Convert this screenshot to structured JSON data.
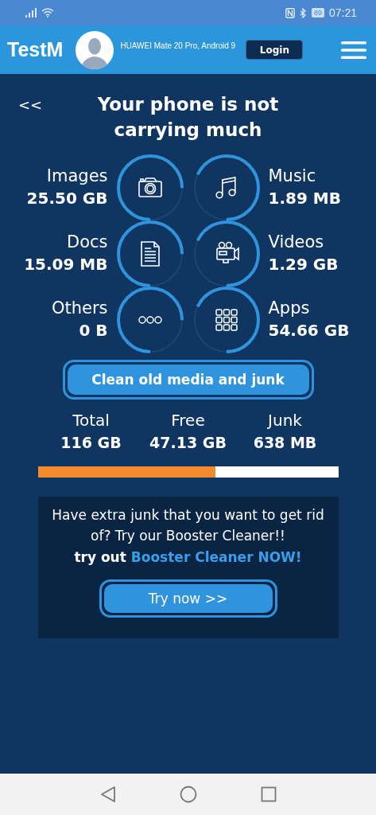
{
  "status_bar": {
    "battery": "89",
    "time": "07:21"
  },
  "header": {
    "logo": "TestM",
    "device": "HUAWEI Mate 20 Pro, Android 9",
    "login": "Login"
  },
  "back": "<<",
  "title": "Your phone is not carrying much",
  "categories": [
    {
      "label": "Images",
      "size": "25.50 GB",
      "kind": "camera"
    },
    {
      "label": "Music",
      "size": "1.89 MB",
      "kind": "music"
    },
    {
      "label": "Docs",
      "size": "15.09 MB",
      "kind": "doc"
    },
    {
      "label": "Videos",
      "size": "1.29 GB",
      "kind": "video"
    },
    {
      "label": "Others",
      "size": "0 B",
      "kind": "dots"
    },
    {
      "label": "Apps",
      "size": "54.66 GB",
      "kind": "grid"
    }
  ],
  "clean_button": "Clean old media and junk",
  "summary": [
    {
      "label": "Total",
      "value": "116 GB"
    },
    {
      "label": "Free",
      "value": "47.13 GB"
    },
    {
      "label": "Junk",
      "value": "638 MB"
    }
  ],
  "storage_bar": {
    "level": 0.59
  },
  "promo": {
    "text": "Have extra junk that you want to get rid of? Try our Booster Cleaner!!",
    "cta_prefix": "try out",
    "cta_highlight": "Booster Cleaner NOW!",
    "button": "Try now >>"
  }
}
